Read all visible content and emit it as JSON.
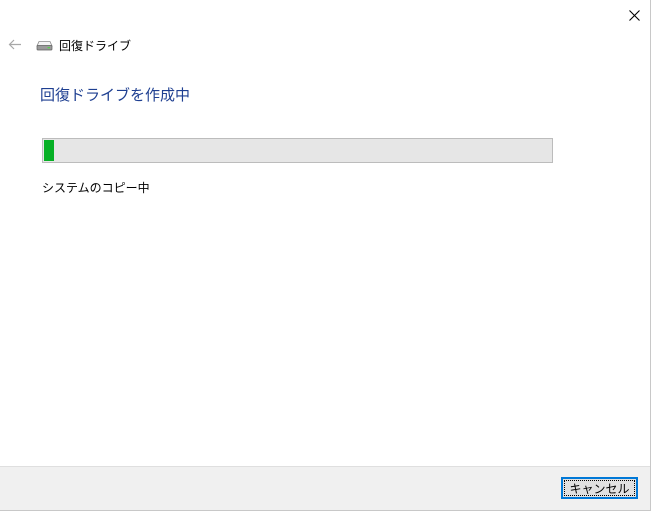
{
  "window": {
    "title": "回復ドライブ",
    "close_icon": "close-icon",
    "back_icon": "back-arrow-icon",
    "title_icon": "drive-icon"
  },
  "main": {
    "heading": "回復ドライブを作成中",
    "progress": {
      "percent": 2,
      "color": "#06b025"
    },
    "status": "システムのコピー中"
  },
  "footer": {
    "cancel_label": "キャンセル"
  },
  "colors": {
    "heading": "#1e3f91",
    "accent_border": "#0078d7",
    "footer_bg": "#f0f0f0"
  }
}
